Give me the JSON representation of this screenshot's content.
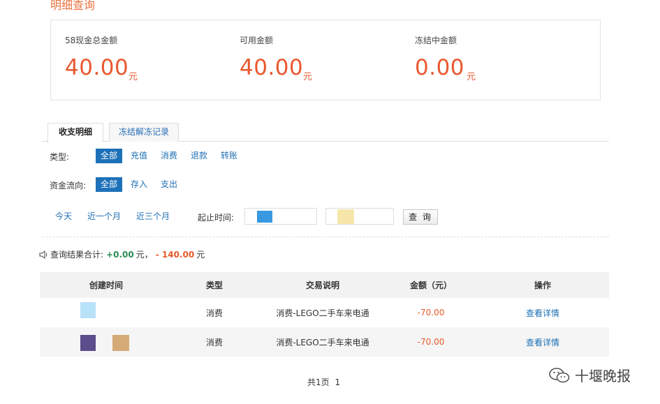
{
  "page": {
    "title": "明细查询"
  },
  "summary": [
    {
      "label": "58现金总金额",
      "value": "40.00",
      "unit": "元"
    },
    {
      "label": "可用金额",
      "value": "40.00",
      "unit": "元"
    },
    {
      "label": "冻结中金额",
      "value": "0.00",
      "unit": "元"
    }
  ],
  "tabs": [
    {
      "label": "收支明细",
      "active": true
    },
    {
      "label": "冻结解冻记录",
      "active": false
    }
  ],
  "filters": {
    "type": {
      "label": "类型:",
      "options": [
        "全部",
        "充值",
        "消费",
        "退款",
        "转账"
      ],
      "selected": "全部"
    },
    "flow": {
      "label": "资金流向:",
      "options": [
        "全部",
        "存入",
        "支出"
      ],
      "selected": "全部"
    },
    "quick_ranges": [
      "今天",
      "近一个月",
      "近三个月"
    ],
    "date_range_label": "起止时间:",
    "query_button": "查 询"
  },
  "result": {
    "prefix": "查询结果合计:",
    "income": "+0.00",
    "income_unit": "元，",
    "expense": "- 140.00",
    "expense_unit": "元"
  },
  "table": {
    "columns": [
      "创建时间",
      "类型",
      "交易说明",
      "金额（元）",
      "操作"
    ],
    "rows": [
      {
        "type": "消费",
        "description": "消费-LEGO二手车来电通",
        "amount": "-70.00",
        "action": "查看详情"
      },
      {
        "type": "消费",
        "description": "消费-LEGO二手车来电通",
        "amount": "-70.00",
        "action": "查看详情"
      }
    ]
  },
  "pagination": {
    "total": "共1页",
    "current": "1"
  },
  "watermark": {
    "text": "十堰晚报",
    "icon": "wechat-icon"
  },
  "colors": {
    "accent": "#e9582f",
    "primary": "#1d71b8",
    "positive": "#2e8b57"
  }
}
